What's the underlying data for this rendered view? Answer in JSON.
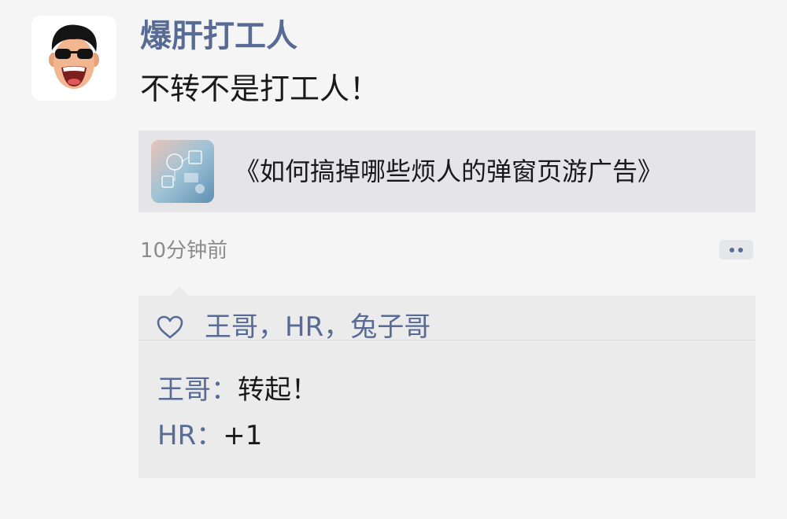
{
  "post": {
    "username": "爆肝打工人",
    "text": "不转不是打工人！",
    "link": {
      "title": "《如何搞掉哪些烦人的弹窗页游广告》",
      "thumbnail_icon": "tech-collage-thumbnail"
    },
    "timestamp": "10分钟前",
    "more_icon": "more-dots-icon"
  },
  "likes": {
    "icon": "heart-outline-icon",
    "names": "王哥，HR，兔子哥"
  },
  "comments": [
    {
      "author": "王哥：",
      "text": "转起！"
    },
    {
      "author": "HR：",
      "text": "+1"
    }
  ],
  "colors": {
    "link_blue": "#576b95",
    "text_dark": "#191919",
    "meta_gray": "#8c8c8c",
    "page_bg": "#f5f5f5",
    "card_bg": "#e5e4e6",
    "panel_bg": "#ebebeb"
  }
}
